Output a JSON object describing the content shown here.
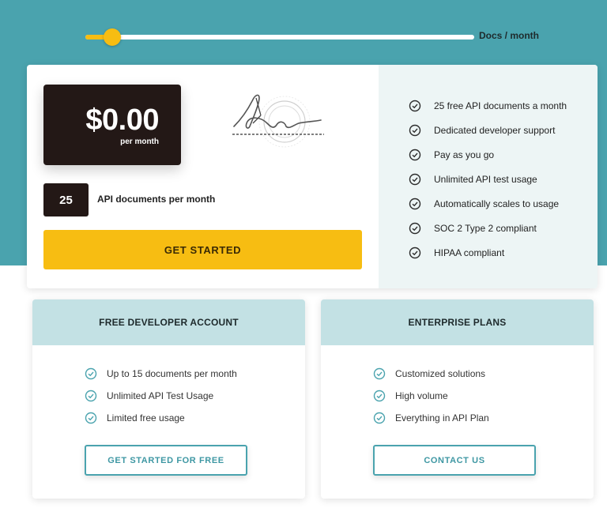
{
  "slider": {
    "label": "Docs / month",
    "fill_fraction": 0.04
  },
  "pricing": {
    "amount": "$0.00",
    "period": "per month",
    "quantity": "25",
    "quantity_label": "API documents per month",
    "cta": "GET STARTED"
  },
  "features": [
    "25 free API documents a month",
    "Dedicated developer support",
    "Pay as you go",
    "Unlimited API test usage",
    "Automatically scales to usage",
    "SOC 2 Type 2 compliant",
    "HIPAA compliant"
  ],
  "plans": [
    {
      "title": "FREE DEVELOPER ACCOUNT",
      "items": [
        "Up to 15 documents per month",
        "Unlimited API Test Usage",
        "Limited free usage"
      ],
      "button": "GET STARTED FOR FREE"
    },
    {
      "title": "ENTERPRISE PLANS",
      "items": [
        "Customized solutions",
        "High volume",
        "Everything in API Plan"
      ],
      "button": "CONTACT US"
    }
  ],
  "icons": {
    "feature_check": "check-circle-icon",
    "plan_check": "check-circle-icon",
    "signature": "signature-graphic"
  },
  "colors": {
    "teal": "#4aa3ae",
    "accent_yellow": "#f7bd12",
    "dark": "#231816",
    "plan_header": "#c3e1e4",
    "feature_panel": "#edf5f5"
  }
}
